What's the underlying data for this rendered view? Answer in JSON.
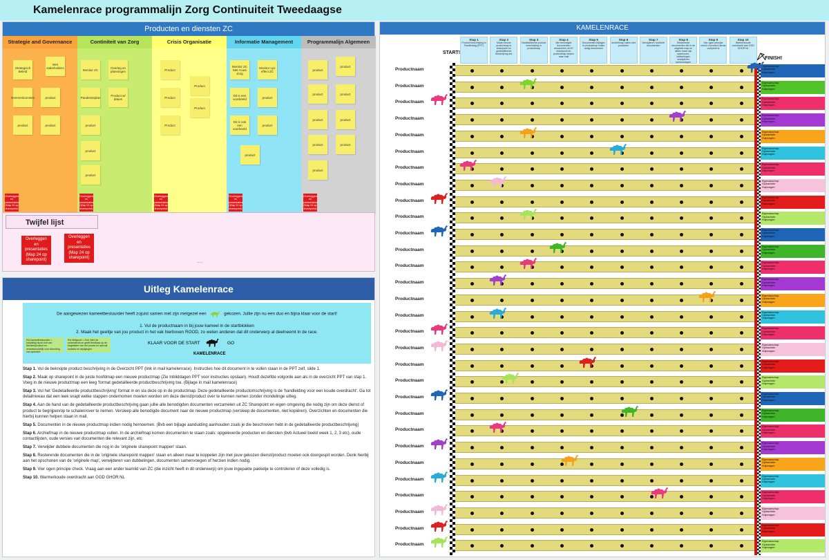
{
  "title": "Kamelenrace programmalijn Zorg Continuiteit Tweedaagse",
  "products_board": {
    "title": "Producten en diensten ZC",
    "columns": [
      {
        "name": "Strategie and Governance",
        "color": "#fbb24c",
        "head": "#fba23a"
      },
      {
        "name": "Continiteit van Zorg",
        "color": "#c8ec70",
        "head": "#b7e45a"
      },
      {
        "name": "Crisis Organisatie",
        "color": "#ffff8a",
        "head": "#ffff70"
      },
      {
        "name": "Informatie Management",
        "color": "#8fe4f6",
        "head": "#62d6f0"
      },
      {
        "name": "Programmalijn Algemeen",
        "color": "#d2d2d2",
        "head": "#bcbcbc"
      }
    ],
    "notes_c1": [
      "Strategisch Beleid",
      "Wet stakeholders",
      "Overeenkomsten",
      "product",
      "product",
      "product"
    ],
    "notes_c2": [
      "Monitor ZC",
      "Overleg en planningen",
      "Pandemieplan",
      "Product w/ datum",
      "product",
      "product",
      "product"
    ],
    "notes_c3": [
      "Product",
      "Product",
      "Product",
      "Product",
      "Product"
    ],
    "notes_c4": [
      "Monitor ZC Met Acute Zorg",
      "Monitor Lpc effect ZC",
      "Dit is een voorbeeld",
      "product",
      "Dit is ook een voorbeeld",
      "product",
      "product"
    ],
    "notes_c5": [
      "product",
      "product",
      "product",
      "product",
      "product",
      "product",
      "product",
      "product",
      "product"
    ],
    "red_small": "Overleggen en presentaties (Map 24 op sharepoint)",
    "twijfel_title": "Twijfel lijst",
    "twijfel_red": [
      "Overleggen en presentaties (Map 24 op sharepoint)",
      "Overleggen en presentaties (Map 24 op sharepoint)"
    ],
    "ellipsis": "....."
  },
  "uitleg": {
    "title": "Uitleg Kamelenrace",
    "intro1": "De aangewezen kameelbestuurder heeft zojuist samen met zijn metgezel een",
    "intro1b": "gekozen. Jullie zijn nu een duo en bijna klaar voor de start!",
    "intro2": "1.  Vul de productnaam in bij jouw kameel in de startblokken",
    "intro3": "2. Maak het geeltje van jou product in het vak hierboven ROOD, zo weten anderen dat dit onderwerp al deelneemt in de race.",
    "box1": "Rol kameelbestuurder = (Vrijwillig) bij de bolt van dienstenproduct en verantwoordelijk voor afronding van opdracht.",
    "box2": "Rol Metgezel = Ook 'vliet' de ondersteunt en geeft feedback op de begeleider van het proces en aanvult toolsets en wijzigingen.",
    "klaar": "KLAAR VOOR DE START",
    "go": "GO",
    "kamelenrace": "KAMELENRACE",
    "steps": [
      {
        "n": "Stap 1.",
        "t": "Vul de beknopte product beschrijving in de Overzicht PPT (link in mail kamelenrace). Instructies hoe dit document in te vullen staan in de PPT zelf, slide 1."
      },
      {
        "n": "Stap 2.",
        "t": "Maak op sharepoint in de juiste hoofdmap een nieuwe productmap (Zie Inbliddagen PPT voor instructies opslaan). Houdt dezelfde volgorde aan als in de overzicht PPT van stap 1. Voeg in de nieuwe productmap een leeg 'format gedetailleerde productbeschrijving toe. (Bijlage in mail kamelenrace)"
      },
      {
        "n": "Stap 3.",
        "t": "Vul het 'Gedetailleerde productbeschrijving' format in en sla deze op in de productmap. Deze gedetailleerde productomschrijving is de 'handleiding voor een koude overdracht'. Ga tot detailniveau dat een leek snapt welke stappen ondernomen moeten worden om deze dienst/product over te kunnen nemen zonder mondelinge uitleg."
      },
      {
        "n": "Stap 4.",
        "t": "Aan de hand van de gedetailleerde productbeschrijving gaan jullie alle benodigden documenten verzamelen uit ZC Sharepoint en eigen omgeving die nodig zijn om deze dienst of product te begrijpen/op te schalen/over te nemen. Versleep alle benodigde document naar de nieuwe productmap (versleep de documenten, niet kopiëren). Overzichten en documenten die hierbij kunnen helpen staan in mail."
      },
      {
        "n": "Stap 5.",
        "t": "Documenten in de nieuwe productmap indien nodig hernoemen. (Bvb een bijlage aanduiding aanhouden zoals je die beschreven hebt in de gedetailleerde productbeschrijving)"
      },
      {
        "n": "Stap 6.",
        "t": "Archiefmap in de nieuwe productmap vullen. In de archiefmap komen documenten te staan zoals: opgeleverde producten en diensten (bvb Actueel beeld week 1, 2, 3 etc), oude contactlijsten, oude versies van documenten die relevant zijn, etc"
      },
      {
        "n": "Stap 7.",
        "t": "Verwijder dubbele documenten die nog in de 'originele sharepoint mappen' staan."
      },
      {
        "n": "Stap 8.",
        "t": "Resterende documenten die in de 'originele sharepoint mappen' staan en alleen maar te koppelen zijn met jouw gekozen dienst/product moeten ook doorgespit worden. Denk hierbij aan het opschonen van de 'originele map', verwijderen van dubbelingen, documenten samenvoegen of herzien indien nodig."
      },
      {
        "n": "Stap 9.",
        "t": "Vier ogen principe check. Vraag aan een ander teamlid van ZC (die inzicht heeft in dit onderwerp) om jouw ingepakte pakketje te controleren of deze volledig is."
      },
      {
        "n": "Stap 10.",
        "t": "Warme/koude overdracht aan GGD GHOR NL"
      }
    ]
  },
  "race": {
    "title": "KAMELENRACE",
    "start": "START!",
    "finish": "FINISH!",
    "steps": [
      {
        "h": "Stap 1",
        "t": "Product beschrijving in Familiedtag (PPT)"
      },
      {
        "h": "Stap 2",
        "t": "Maak nieuwe productmap in sharepoint en gedetailleerde beschrijving toe"
      },
      {
        "h": "Stap 3",
        "t": "Gedetailleerde product beschrijving in productmap"
      },
      {
        "h": "Stap 4",
        "t": "Alle benodigde documenten verzamelen uit ZC sharepoint en productmap slepen naar mail"
      },
      {
        "h": "Stap 5",
        "t": "Documenten bijlagen in productmap indien nodig hernoemen"
      },
      {
        "h": "Stap 6",
        "t": "Archiefmap vullen met producten"
      },
      {
        "h": "Stap 7",
        "t": "Verwijderen 'dubbele' documenten"
      },
      {
        "h": "Stap 8",
        "t": "Resterende documenten die in de originele map en alleen maar zijn opschonen, dubbelingen verwijderen samenvoegen"
      },
      {
        "h": "Stap 9",
        "t": "Vier ogen principe check of product dienst compleet is"
      },
      {
        "h": "Stap 10",
        "t": "Warme/koude overdracht aan GGD GHOR NL"
      }
    ],
    "lane_label": "Productnaam",
    "owner_text": [
      "Eigenaarschap:",
      "Opdrachtde:",
      "Hulpvragen:"
    ],
    "lanes": [
      {
        "camel": "#2563b5",
        "pos": 9.6,
        "box": "#1f66b8"
      },
      {
        "camel": "#7fd32e",
        "pos": 2,
        "box": "#52c22a"
      },
      {
        "camel": "#e83b7e",
        "pos": -1,
        "box": "#ef2f6b"
      },
      {
        "camel": "#a241c8",
        "pos": 7,
        "box": "#a43ad3"
      },
      {
        "camel": "#f4a21d",
        "pos": 2,
        "box": "#f9a51c"
      },
      {
        "camel": "#2aaad4",
        "pos": 5,
        "box": "#2fc3e0"
      },
      {
        "camel": "#e83b7e",
        "pos": 0,
        "box": "#ef2f6b"
      },
      {
        "camel": "#f3b8d8",
        "pos": 1,
        "box": "#f7c2dc"
      },
      {
        "camel": "#dd2020",
        "pos": -1,
        "box": "#e51c1c"
      },
      {
        "camel": "#a8e35c",
        "pos": 2,
        "box": "#b4e86a"
      },
      {
        "camel": "#1f66b8",
        "pos": -1,
        "box": "#1f66b8"
      },
      {
        "camel": "#3fb52a",
        "pos": 3,
        "box": "#3fb52a"
      },
      {
        "camel": "#e83b7e",
        "pos": 2,
        "box": "#ef2f6b"
      },
      {
        "camel": "#a241c8",
        "pos": 1,
        "box": "#a43ad3"
      },
      {
        "camel": "#f4a21d",
        "pos": 8,
        "box": "#f9a51c"
      },
      {
        "camel": "#2aaad4",
        "pos": 1,
        "box": "#2fc3e0"
      },
      {
        "camel": "#e83b7e",
        "pos": -1,
        "box": "#ef2f6b"
      },
      {
        "camel": "#f3b8d8",
        "pos": -1,
        "box": "#f7c2dc"
      },
      {
        "camel": "#dd2020",
        "pos": 4,
        "box": "#e51c1c"
      },
      {
        "camel": "#a8e35c",
        "pos": 1.4,
        "box": "#b4e86a"
      },
      {
        "camel": "#1f66b8",
        "pos": -1,
        "box": "#1f66b8"
      },
      {
        "camel": "#3fb52a",
        "pos": 5.4,
        "box": "#3fb52a"
      },
      {
        "camel": "#e83b7e",
        "pos": 1,
        "box": "#ef2f6b"
      },
      {
        "camel": "#a241c8",
        "pos": -1,
        "box": "#a43ad3"
      },
      {
        "camel": "#f4a21d",
        "pos": 3.4,
        "box": "#f9a51c"
      },
      {
        "camel": "#2aaad4",
        "pos": -1,
        "box": "#2fc3e0"
      },
      {
        "camel": "#e83b7e",
        "pos": 6.4,
        "box": "#ef2f6b"
      },
      {
        "camel": "#f3b8d8",
        "pos": -1,
        "box": "#f7c2dc"
      },
      {
        "camel": "#dd2020",
        "pos": -1,
        "box": "#e51c1c"
      },
      {
        "camel": "#a8e35c",
        "pos": -1,
        "box": "#b4e86a"
      }
    ]
  }
}
